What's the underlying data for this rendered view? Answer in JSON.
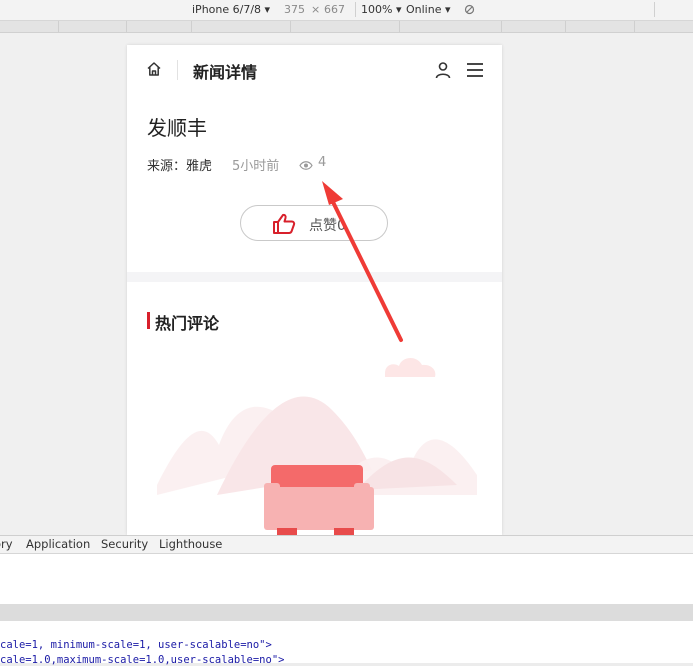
{
  "toolbar": {
    "device": "iPhone 6/7/8",
    "device_arrow": "▾",
    "width": "375",
    "times": "×",
    "height": "667",
    "zoom": "100%",
    "zoom_arrow": "▾",
    "network": "Online",
    "network_arrow": "▾",
    "rotate_icon": "rotate-icon"
  },
  "page": {
    "nav_title": "新闻详情",
    "article_title": "发顺丰",
    "source_label": "来源：雅虎",
    "time_ago": "5小时前",
    "view_count": "4",
    "like_label": "点赞",
    "like_count": "0",
    "comments_title": "热门评论"
  },
  "devtools": {
    "tabs": [
      "ory",
      "Application",
      "Security",
      "Lighthouse"
    ],
    "code_lines": [
      "cale=1, minimum-scale=1, user-scalable=no\">",
      "cale=1.0,maximum-scale=1.0,user-scalable=no\">"
    ]
  },
  "colors": {
    "accent": "#d8202b",
    "arrow": "#ef3b36",
    "illustration": "#f46a6a"
  }
}
